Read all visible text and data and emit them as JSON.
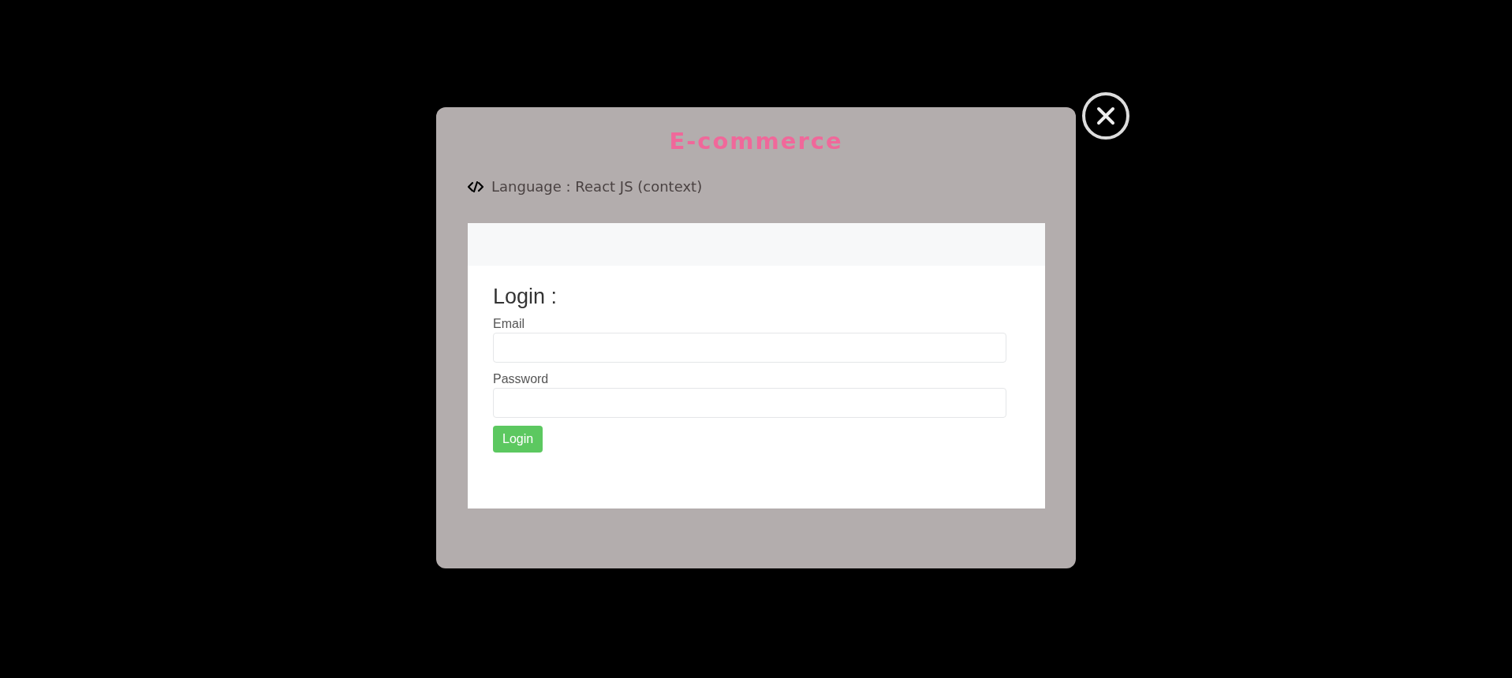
{
  "modal": {
    "title": "E-commerce",
    "language_line": "Language : React JS (context)"
  },
  "preview": {
    "heading": "Login :",
    "fields": [
      {
        "label": "Email"
      },
      {
        "label": "Password"
      }
    ],
    "button": "Login"
  }
}
